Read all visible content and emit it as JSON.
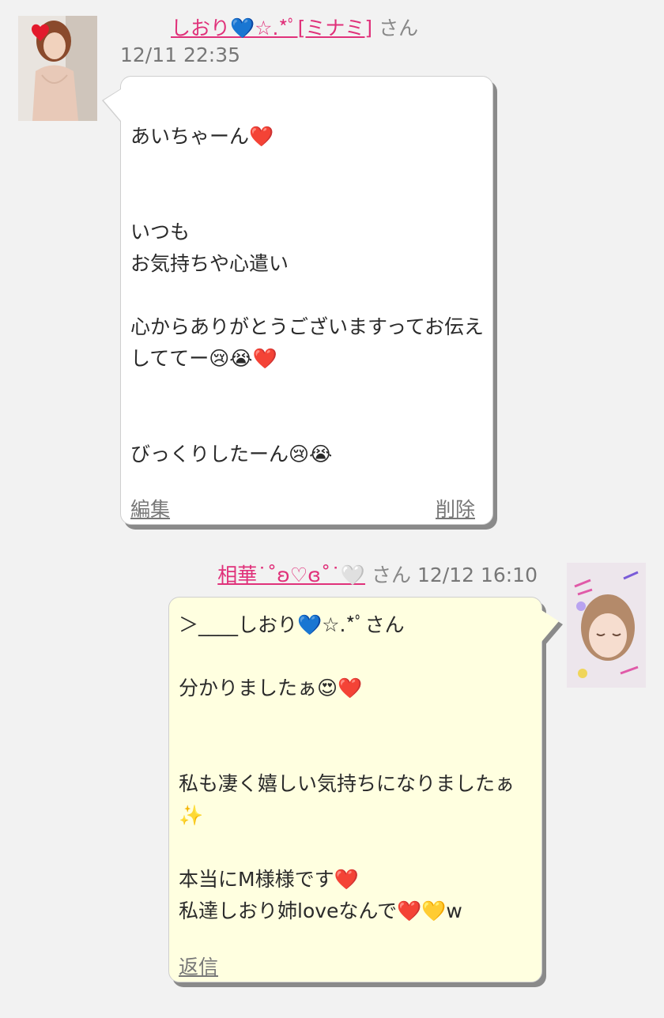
{
  "messages": [
    {
      "sender_prefix_blank": "____",
      "sender": "しおり💙☆.*ﾟ[ミナミ]",
      "honorific": "さん",
      "timestamp": "12/11 22:35",
      "body": "あいちゃーん❤️\n\n\nいつも\nお気持ちや心遣い\n\n心からありがとうございますってお伝えしててー😢😭❤️\n\n\nびっくりしたーん😢😭",
      "actions": {
        "edit": "編集",
        "delete": "削除"
      }
    },
    {
      "sender": "相華˙˚ʚ♡ɞ˚˙🤍",
      "honorific": "さん",
      "timestamp": "12/12 16:10",
      "body": "＞____しおり💙☆.*ﾟさん\n\n分かりましたぁ😍❤️\n\n\n私も凄く嬉しい気持ちになりましたぁ✨\n\n本当にM様様です❤️\n私達しおり姉loveなんで❤️💛w",
      "actions": {
        "reply": "返信"
      }
    }
  ],
  "colors": {
    "background": "#f2f2f2",
    "name_link": "#e0317a",
    "bubble_left": "#ffffff",
    "bubble_right": "#ffffe0",
    "shadow": "#8a8a8a",
    "muted_text": "#777777"
  },
  "icons": {
    "avatar_left": "user-avatar-photo",
    "avatar_right": "user-avatar-photo"
  }
}
